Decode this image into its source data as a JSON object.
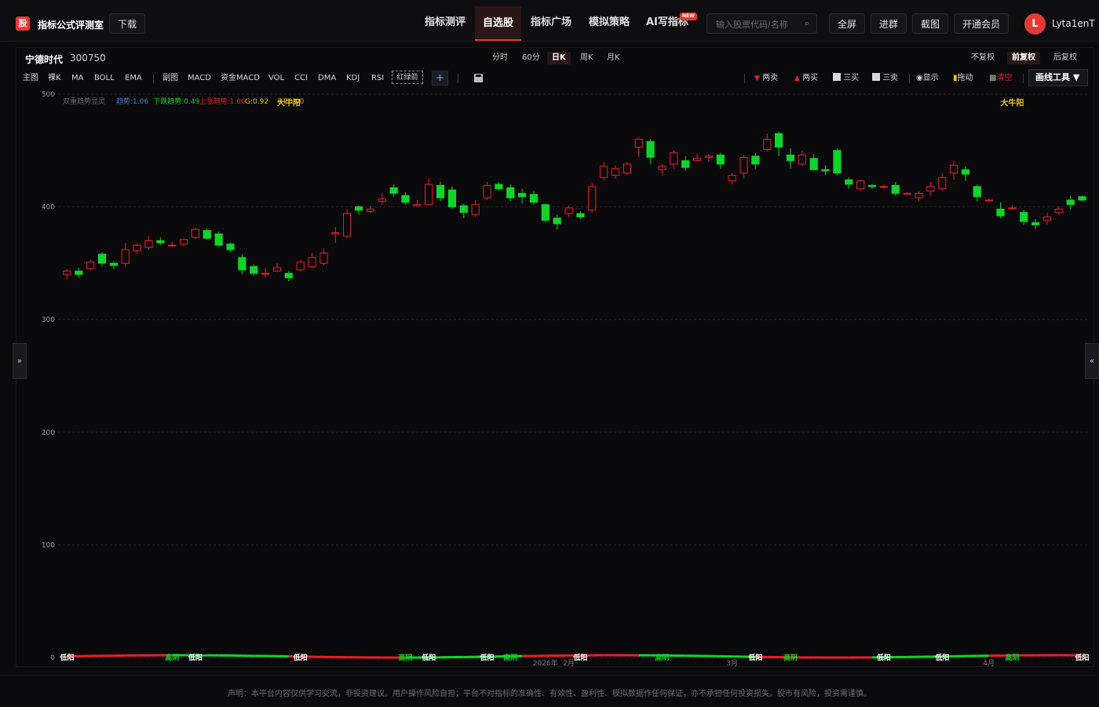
{
  "app": {
    "logo_char": "股",
    "title": "指标公式评测室",
    "download": "下载"
  },
  "nav": [
    "指标测评",
    "自选股",
    "指标广场",
    "模拟策略",
    "AI写指标"
  ],
  "nav_new_tag": "NEW",
  "search": {
    "placeholder": "输入股票代码/名称"
  },
  "top_buttons": {
    "fullscreen": "全屏",
    "join_group": "进群",
    "screenshot": "截图",
    "vip": "开通会员"
  },
  "user": {
    "avatar_letter": "L",
    "name": "Lyta1enT"
  },
  "stock": {
    "name": "宁德时代",
    "code": "300750"
  },
  "periods": [
    "分时",
    "60分",
    "日K",
    "周K",
    "月K"
  ],
  "active_period": "日K",
  "adjust": [
    "不复权",
    "前复权",
    "后复权"
  ],
  "active_adjust": "前复权",
  "indicators_main": [
    "主图",
    "裸K",
    "MA",
    "BOLL",
    "EMA"
  ],
  "indicators_sub": [
    "副图",
    "MACD",
    "资金MACD",
    "VOL",
    "CCI",
    "DMA",
    "KDJ",
    "RSI"
  ],
  "hongluijian": "红绿箭",
  "plus": "+",
  "tools": {
    "sell2": "两卖",
    "buy2": "两买",
    "buy3": "三买",
    "sell3": "三卖",
    "show": "显示",
    "drag": "拖动",
    "clear": "清空",
    "draw": "画线工具 ▼"
  },
  "side_left": "»",
  "side_right": "«",
  "disclaimer": "声明：本平台内容仅供学习交流，非投资建议。用户操作风险自担；平台不对指标的准确性、有效性、盈利性、模拟数据作任何保证，亦不承担任何投资损失。股市有风险，投资需谨慎。",
  "chart_data": {
    "type": "candlestick",
    "title": "",
    "y_ticks": [
      0,
      100,
      200,
      300,
      400,
      500
    ],
    "ylim": [
      0,
      500
    ],
    "grid": true,
    "legend": {
      "name": "双重趋势显灵",
      "items": [
        {
          "label": "趋势:1.06",
          "color": "#3b7dd8"
        },
        {
          "label": "下跌趋势:0.49",
          "color": "#11d42a"
        },
        {
          "label": "上涨趋势:1.06",
          "color": "#e8202a"
        },
        {
          "label": "G:0.92",
          "color": "#e8c21a"
        },
        {
          "label": "BT:0.00",
          "color": "#f29a2e"
        }
      ]
    },
    "annotations": [
      {
        "text": "大牛阳",
        "index": 19,
        "price": 490,
        "color": "#e8c21a"
      },
      {
        "text": "大牛阳",
        "index": 81,
        "price": 490,
        "color": "#e8c21a"
      }
    ],
    "bottom_labels": [
      {
        "text": "低阳",
        "index": 0,
        "color": "#ffffff"
      },
      {
        "text": "高阴",
        "index": 9,
        "color": "#11d42a"
      },
      {
        "text": "低阳",
        "index": 11,
        "color": "#ffffff"
      },
      {
        "text": "低阳",
        "index": 20,
        "color": "#ffffff"
      },
      {
        "text": "高阴",
        "index": 29,
        "color": "#11d42a"
      },
      {
        "text": "低阳",
        "index": 31,
        "color": "#ffffff"
      },
      {
        "text": "低阳",
        "index": 36,
        "color": "#ffffff"
      },
      {
        "text": "高阴",
        "index": 38,
        "color": "#11d42a"
      },
      {
        "text": "低阳",
        "index": 44,
        "color": "#ffffff"
      },
      {
        "text": "高阴",
        "index": 51,
        "color": "#11d42a"
      },
      {
        "text": "低阳",
        "index": 59,
        "color": "#ffffff"
      },
      {
        "text": "高阴",
        "index": 62,
        "color": "#11d42a"
      },
      {
        "text": "低阳",
        "index": 70,
        "color": "#ffffff"
      },
      {
        "text": "低阳",
        "index": 75,
        "color": "#ffffff"
      },
      {
        "text": "高阴",
        "index": 81,
        "color": "#11d42a"
      },
      {
        "text": "低阳",
        "index": 87,
        "color": "#ffffff"
      }
    ],
    "x_labels": [
      {
        "text": "2026年",
        "index": 41
      },
      {
        "text": "2月",
        "index": 43
      },
      {
        "text": "3月",
        "index": 57
      },
      {
        "text": "4月",
        "index": 79
      }
    ],
    "candles": [
      [
        340,
        343,
        336,
        345
      ],
      [
        343,
        340,
        337,
        346
      ],
      [
        345,
        351,
        344,
        353
      ],
      [
        358,
        350,
        347,
        360
      ],
      [
        350,
        348,
        345,
        352
      ],
      [
        350,
        362,
        347,
        368
      ],
      [
        361,
        366,
        358,
        368
      ],
      [
        364,
        370,
        362,
        374
      ],
      [
        370,
        368,
        366,
        373
      ],
      [
        366,
        366,
        364,
        369
      ],
      [
        367,
        371,
        365,
        372
      ],
      [
        373,
        380,
        371,
        382
      ],
      [
        379,
        372,
        371,
        381
      ],
      [
        376,
        366,
        364,
        378
      ],
      [
        367,
        362,
        360,
        368
      ],
      [
        355,
        344,
        340,
        358
      ],
      [
        347,
        341,
        339,
        349
      ],
      [
        341,
        341,
        337,
        346
      ],
      [
        343,
        346,
        342,
        350
      ],
      [
        341,
        337,
        334,
        343
      ],
      [
        344,
        351,
        343,
        353
      ],
      [
        347,
        355,
        346,
        359
      ],
      [
        350,
        359,
        348,
        363
      ],
      [
        376,
        377,
        368,
        382
      ],
      [
        374,
        394,
        372,
        398
      ],
      [
        400,
        397,
        393,
        401
      ],
      [
        396,
        398,
        394,
        401
      ],
      [
        405,
        407,
        402,
        412
      ],
      [
        417,
        412,
        409,
        420
      ],
      [
        410,
        404,
        402,
        413
      ],
      [
        401,
        402,
        400,
        406
      ],
      [
        402,
        420,
        401,
        425
      ],
      [
        419,
        408,
        405,
        422
      ],
      [
        415,
        400,
        398,
        418
      ],
      [
        401,
        395,
        390,
        403
      ],
      [
        393,
        402,
        391,
        406
      ],
      [
        408,
        419,
        406,
        422
      ],
      [
        420,
        416,
        414,
        422
      ],
      [
        417,
        408,
        405,
        420
      ],
      [
        412,
        409,
        403,
        416
      ],
      [
        411,
        404,
        402,
        414
      ],
      [
        402,
        388,
        386,
        403
      ],
      [
        390,
        385,
        380,
        393
      ],
      [
        394,
        399,
        391,
        401
      ],
      [
        394,
        391,
        389,
        396
      ],
      [
        397,
        418,
        395,
        421
      ],
      [
        426,
        436,
        423,
        440
      ],
      [
        428,
        434,
        425,
        437
      ],
      [
        430,
        438,
        428,
        440
      ],
      [
        453,
        460,
        444,
        462
      ],
      [
        458,
        444,
        438,
        460
      ],
      [
        433,
        436,
        428,
        438
      ],
      [
        438,
        448,
        434,
        450
      ],
      [
        441,
        435,
        432,
        445
      ],
      [
        441,
        443,
        440,
        447
      ],
      [
        444,
        445,
        440,
        447
      ],
      [
        446,
        438,
        434,
        448
      ],
      [
        423,
        428,
        420,
        430
      ],
      [
        430,
        444,
        425,
        446
      ],
      [
        445,
        438,
        434,
        448
      ],
      [
        451,
        460,
        449,
        465
      ],
      [
        465,
        453,
        445,
        467
      ],
      [
        446,
        441,
        434,
        452
      ],
      [
        438,
        446,
        436,
        450
      ],
      [
        443,
        433,
        432,
        447
      ],
      [
        433,
        432,
        428,
        437
      ],
      [
        450,
        430,
        428,
        452
      ],
      [
        424,
        420,
        416,
        426
      ],
      [
        416,
        423,
        414,
        424
      ],
      [
        419,
        418,
        416,
        420
      ],
      [
        418,
        418,
        416,
        420
      ],
      [
        419,
        412,
        410,
        422
      ],
      [
        412,
        412,
        412,
        413
      ],
      [
        408,
        412,
        405,
        414
      ],
      [
        414,
        418,
        410,
        422
      ],
      [
        416,
        426,
        414,
        430
      ],
      [
        430,
        437,
        424,
        441
      ],
      [
        433,
        429,
        423,
        436
      ],
      [
        418,
        409,
        405,
        420
      ],
      [
        406,
        406,
        405,
        407
      ],
      [
        398,
        392,
        390,
        404
      ],
      [
        399,
        399,
        398,
        401
      ],
      [
        395,
        387,
        384,
        397
      ],
      [
        386,
        384,
        380,
        389
      ],
      [
        388,
        391,
        384,
        395
      ],
      [
        395,
        398,
        393,
        400
      ],
      [
        406,
        402,
        398,
        410
      ],
      [
        409,
        406,
        405,
        410
      ]
    ]
  }
}
